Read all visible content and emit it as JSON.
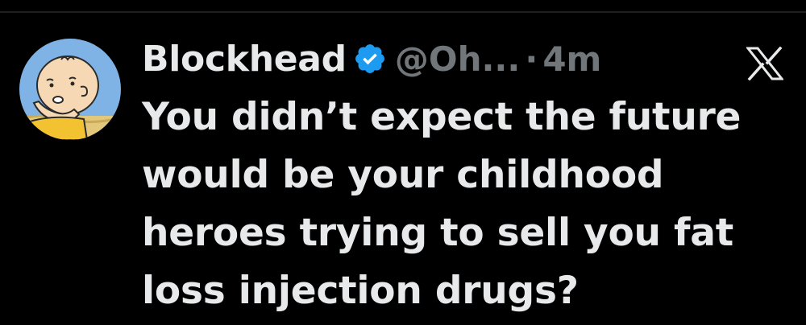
{
  "tweet": {
    "author_name": "Blockhead",
    "handle": "@Oh...",
    "separator": "·",
    "time": "4m",
    "text": "You didn’t expect the future\nwould be your childhood\nheroes trying to sell you fat\nloss injection drugs?"
  },
  "icons": {
    "avatar": "charlie-brown-avatar",
    "verified": "verified-badge-icon",
    "logo": "x-logo-icon"
  },
  "colors": {
    "background": "#000000",
    "primary_text": "#e7e9ea",
    "secondary_text": "#71767b",
    "verified_blue": "#1d9bf0",
    "avatar_bg": "#7fb3e6"
  }
}
